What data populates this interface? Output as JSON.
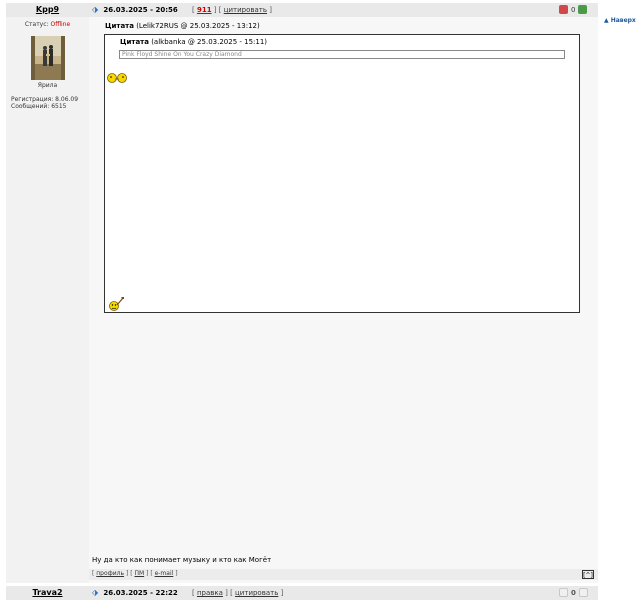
{
  "post1": {
    "author": "Kpp9",
    "date": "26.03.2025 - 20:56",
    "post_number": "911",
    "quote_link": "цитировать",
    "rating_value": "0",
    "status_label": "Статус:",
    "status_value": "Offline",
    "avatar_caption": "Ярила",
    "registration": "Регистрация: 8.06.09",
    "messages": "Сообщений: 6515",
    "quote_author": "(Lelik72RUS @ 25.03.2025 - 13:12)",
    "quote_label": "Цитата",
    "nested_quote_label": "Цитата",
    "nested_quote_author": "(alkbanka @ 25.03.2025 - 15:11)",
    "nested_quote_text": "Pink Floyd Shine On You Crazy Diamond",
    "message_text": "Ну да кто как понимает музыку и кто как Могёт",
    "footer_profile": "профиль",
    "footer_pm": "ПМ",
    "footer_email": "e-mail",
    "to_top_button": "[^]"
  },
  "post2": {
    "author": "Trava2",
    "date": "26.03.2025 - 22:22",
    "edit_link": "правка",
    "quote_link": "цитировать",
    "rating_value": "0"
  },
  "side_link": "▲ Наверх",
  "colors": {
    "status_offline": "#cc0000",
    "accent_blue": "#2a6cc0",
    "header_bg": "#e9e9e9"
  }
}
